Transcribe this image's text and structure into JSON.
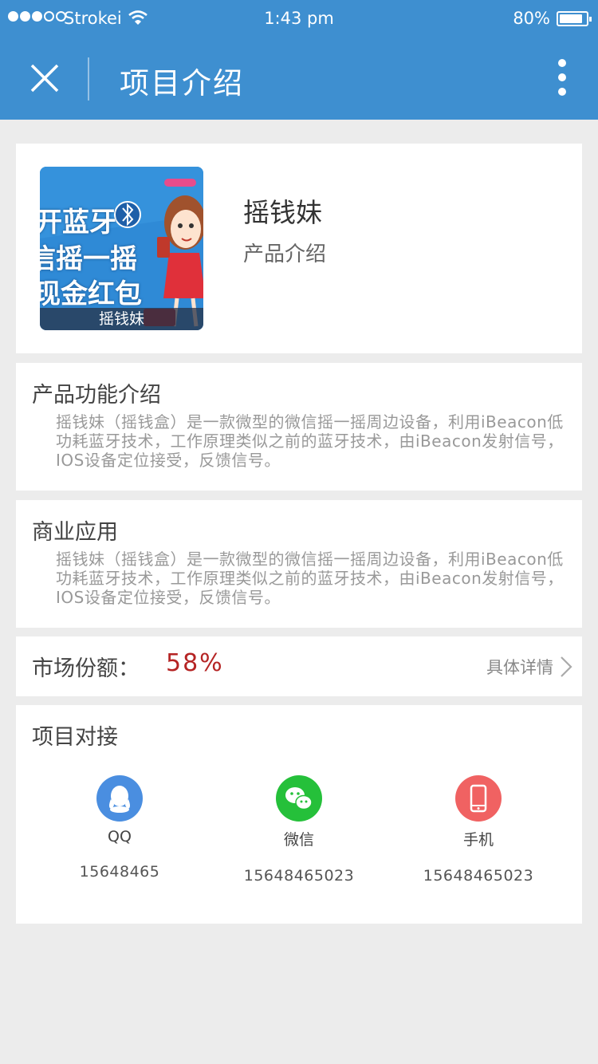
{
  "status_bar": {
    "carrier": "Strokei",
    "time": "1:43 pm",
    "battery": "80%"
  },
  "nav": {
    "title": "项目介绍"
  },
  "product": {
    "name": "摇钱妹",
    "subtitle": "产品介绍",
    "image_caption": "摇钱妹",
    "image_lines": [
      "开蓝牙",
      "信摇一摇",
      "现金红包"
    ]
  },
  "sections": {
    "function": {
      "title": "产品功能介绍",
      "body": "摇钱妹（摇钱盒）是一款微型的微信摇一摇周边设备，利用iBeacon低功耗蓝牙技术，工作原理类似之前的蓝牙技术，由iBeacon发射信号，IOS设备定位接受，反馈信号。"
    },
    "business": {
      "title": "商业应用",
      "body": "摇钱妹（摇钱盒）是一款微型的微信摇一摇周边设备，利用iBeacon低功耗蓝牙技术，工作原理类似之前的蓝牙技术，由iBeacon发射信号，IOS设备定位接受，反馈信号。"
    }
  },
  "market": {
    "label": "市场份额：",
    "value": "58%",
    "detail_label": "具体详情"
  },
  "contacts": {
    "title": "项目对接",
    "items": [
      {
        "label": "QQ",
        "number": "15648465",
        "color": "#4a8ee0",
        "icon": "qq-icon"
      },
      {
        "label": "微信",
        "number": "15648465023",
        "color": "#25c03a",
        "icon": "wechat-icon"
      },
      {
        "label": "手机",
        "number": "15648465023",
        "color": "#f06262",
        "icon": "phone-icon"
      }
    ]
  },
  "colors": {
    "header": "#3e8fd0",
    "background": "#ececec",
    "accent_red": "#b52424"
  }
}
